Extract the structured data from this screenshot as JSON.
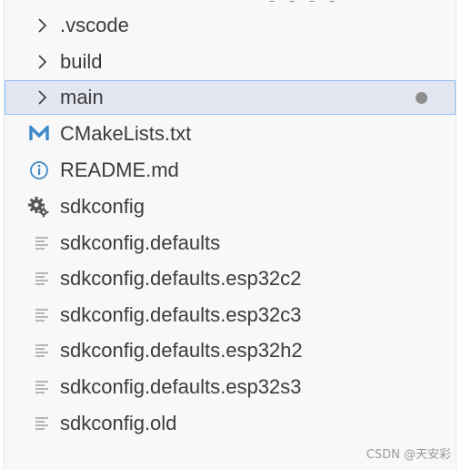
{
  "tree": {
    "items": [
      {
        "label": ".vscode",
        "icon": "chevron-right-icon"
      },
      {
        "label": "build",
        "icon": "chevron-right-icon"
      },
      {
        "label": "main",
        "icon": "chevron-right-icon",
        "selected": true,
        "modified_indicator": "modified-dot-icon"
      },
      {
        "label": "CMakeLists.txt",
        "icon": "cmake-m-icon"
      },
      {
        "label": "README.md",
        "icon": "info-circle-icon"
      },
      {
        "label": "sdkconfig",
        "icon": "gear-icon"
      },
      {
        "label": "sdkconfig.defaults",
        "icon": "file-lines-icon"
      },
      {
        "label": "sdkconfig.defaults.esp32c2",
        "icon": "file-lines-icon"
      },
      {
        "label": "sdkconfig.defaults.esp32c3",
        "icon": "file-lines-icon"
      },
      {
        "label": "sdkconfig.defaults.esp32h2",
        "icon": "file-lines-icon"
      },
      {
        "label": "sdkconfig.defaults.esp32s3",
        "icon": "file-lines-icon"
      },
      {
        "label": "sdkconfig.old",
        "icon": "file-lines-icon"
      }
    ]
  },
  "watermark": "CSDN @天安彩",
  "colors": {
    "text": "#3b3b3b",
    "panel_bg": "#f8f8f8",
    "selected_bg": "#e4e6f1",
    "selected_border": "#90c2f9",
    "cmake_icon": "#3f88c8",
    "info_icon": "#3f88c8",
    "gear_icon": "#555555",
    "file_icon": "#a6a6a6",
    "dot": "#8e8e8e"
  }
}
